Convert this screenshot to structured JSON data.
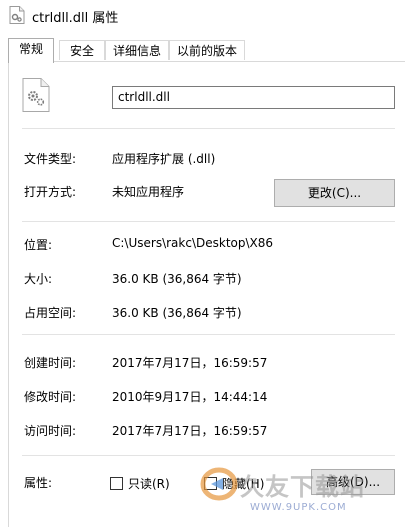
{
  "window": {
    "title": "ctrldll.dll 属性"
  },
  "tabs": [
    {
      "label": "常规",
      "active": true
    },
    {
      "label": "安全",
      "active": false
    },
    {
      "label": "详细信息",
      "active": false
    },
    {
      "label": "以前的版本",
      "active": false
    }
  ],
  "file": {
    "name": "ctrldll.dll",
    "icon": "dll-file-gear-icon"
  },
  "general": {
    "type_label": "文件类型:",
    "type_value": "应用程序扩展 (.dll)",
    "open_label": "打开方式:",
    "open_value": "未知应用程序",
    "change_button": "更改(C)...",
    "location_label": "位置:",
    "location_value": "C:\\Users\\rakc\\Desktop\\X86",
    "size_label": "大小:",
    "size_value": "36.0 KB (36,864 字节)",
    "disk_label": "占用空间:",
    "disk_value": "36.0 KB (36,864 字节)",
    "created_label": "创建时间:",
    "created_value": "2017年7月17日，16:59:57",
    "modified_label": "修改时间:",
    "modified_value": "2010年9月17日，14:44:14",
    "accessed_label": "访问时间:",
    "accessed_value": "2017年7月17日，16:59:57",
    "attributes_label": "属性:",
    "readonly_label": "只读(R)",
    "readonly_checked": false,
    "hidden_label": "隐藏(H)",
    "hidden_checked": false,
    "advanced_button": "高级(D)..."
  },
  "watermark": {
    "text": "久友下载站",
    "sub": "WWW.9UPK.COM"
  }
}
